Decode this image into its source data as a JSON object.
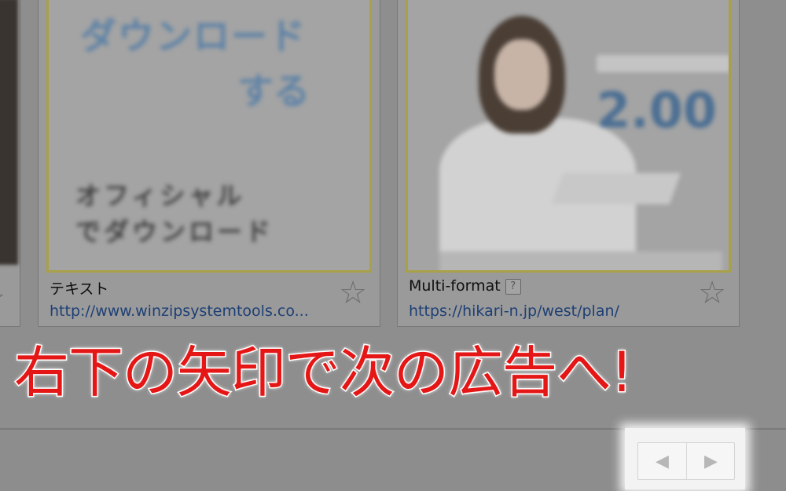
{
  "cards": [
    {
      "title": "テキスト",
      "url": "http://www.winzipsystemtools.co...",
      "ad_text": {
        "line1": "ダウンロード",
        "line2": "する",
        "line3": "",
        "line4": "オフィシャル",
        "line5": "でダウンロード"
      }
    },
    {
      "title": "Multi-format",
      "help": "?",
      "url": "https://hikari-n.jp/west/plan/",
      "ad_text": {
        "price": "2.00"
      }
    }
  ],
  "icons": {
    "star": "☆",
    "prev": "◀",
    "next": "▶"
  },
  "caption": "右下の矢印で次の広告へ!",
  "colors": {
    "caption": "#e51616",
    "link": "#1d3f75",
    "overlay_bg": "#8e8e8e"
  }
}
